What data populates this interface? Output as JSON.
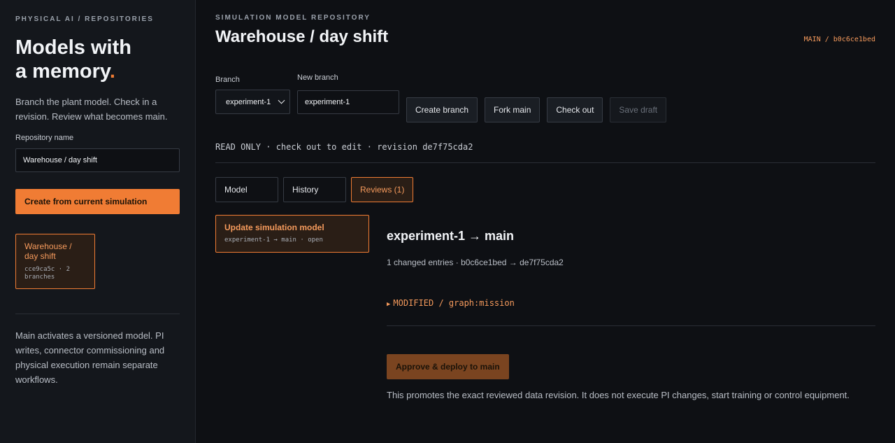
{
  "sidebar": {
    "eyebrow": "PHYSICAL AI / REPOSITORIES",
    "hero_line1": "Models with",
    "hero_line2": "a memory",
    "hero_dot": ".",
    "intro": "Branch the plant model. Check in a revision. Review what becomes main.",
    "repo_name_label": "Repository name",
    "repo_name_value": "Warehouse / day shift",
    "create_button": "Create from current simulation",
    "repo_card": {
      "name": "Warehouse / day shift",
      "meta": "cce9ca5c · 2 branches"
    },
    "note": "Main activates a versioned model. PI writes, connector commissioning and physical execution remain separate workflows."
  },
  "header": {
    "eyebrow": "SIMULATION MODEL REPOSITORY",
    "title": "Warehouse / day shift",
    "revision_badge": "MAIN / b0c6ce1bed"
  },
  "controls": {
    "branch_label": "Branch",
    "branch_selected": "experiment-1",
    "new_branch_label": "New branch",
    "new_branch_value": "experiment-1",
    "create_branch": "Create branch",
    "fork_main": "Fork main",
    "check_out": "Check out",
    "save_draft": "Save draft"
  },
  "status": "READ ONLY · check out to edit · revision de7f75cda2",
  "tabs": [
    {
      "label": "Model"
    },
    {
      "label": "History"
    },
    {
      "label": "Reviews (1)"
    }
  ],
  "review": {
    "card_title": "Update simulation model",
    "card_meta": "experiment-1 → main · open",
    "detail_title": "experiment-1 → main",
    "detail_sub": "1 changed entries · b0c6ce1bed → de7f75cda2",
    "change_icon": "triangle-right-icon",
    "change": "MODIFIED / graph:mission",
    "approve_button": "Approve & deploy to main",
    "footnote": "This promotes the exact reviewed data revision. It does not execute PI changes, start training or control equipment."
  },
  "colors": {
    "accent": "#f07c34",
    "accent_text": "#f59a5c",
    "background": "#0e1014",
    "sidebar": "#14171c"
  }
}
